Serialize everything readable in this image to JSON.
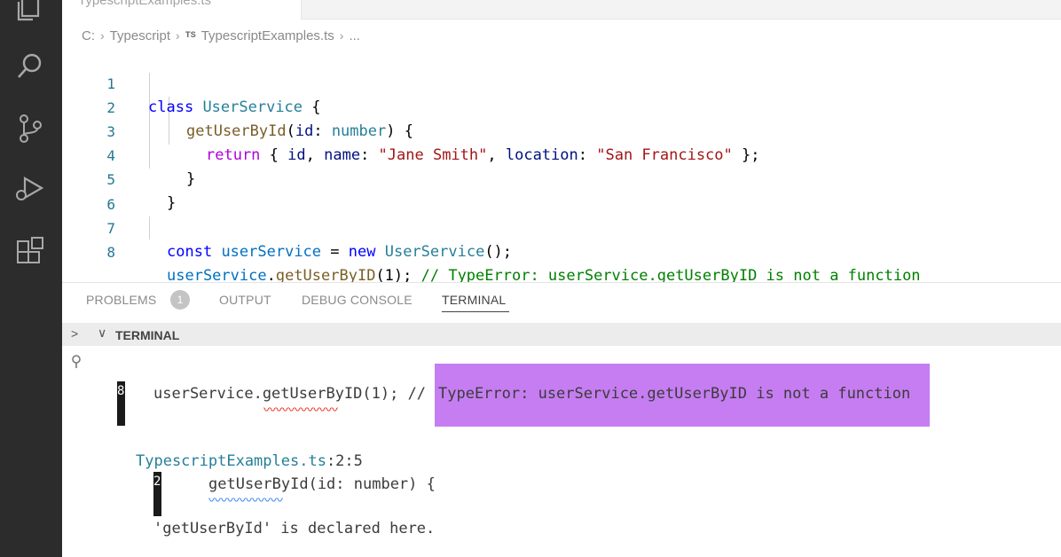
{
  "tab": {
    "label": "TypescriptExamples.ts"
  },
  "breadcrumb": {
    "root": "C:",
    "folder": "Typescript",
    "file_badge": "TS",
    "file": "TypescriptExamples.ts",
    "more": "..."
  },
  "editor": {
    "lines": [
      {
        "num": "1"
      },
      {
        "num": "2"
      },
      {
        "num": "3"
      },
      {
        "num": "4"
      },
      {
        "num": "5"
      },
      {
        "num": "6"
      },
      {
        "num": "7"
      },
      {
        "num": "8"
      }
    ],
    "tokens": {
      "l1_class": "class",
      "l1_name": "UserService",
      "l1_brace": " {",
      "l2_fn": "getUserById",
      "l2_open": "(",
      "l2_param": "id",
      "l2_colon": ": ",
      "l2_type": "number",
      "l2_close": ") {",
      "l3_return": "return",
      "l3_a": " { ",
      "l3_id": "id",
      "l3_b": ", ",
      "l3_name": "name",
      "l3_c": ": ",
      "l3_str1": "\"Jane Smith\"",
      "l3_d": ", ",
      "l3_loc": "location",
      "l3_e": ": ",
      "l3_str2": "\"San Francisco\"",
      "l3_f": " };",
      "l4": "}",
      "l5": "}",
      "l7_const": "const",
      "l7_var": "userService",
      "l7_eq": " = ",
      "l7_new": "new",
      "l7_cls": "UserService",
      "l7_end": "();",
      "l8_var": "userService",
      "l8_dot": ".",
      "l8_fn": "getUserByID",
      "l8_args": "(1); ",
      "l8_comment": "// TypeError: userService.getUserByID is not a function"
    }
  },
  "panel": {
    "tabs": {
      "problems": "PROBLEMS",
      "problems_count": "1",
      "output": "OUTPUT",
      "debug": "DEBUG CONSOLE",
      "terminal": "TERMINAL"
    },
    "terminal_header": "TERMINAL"
  },
  "terminal": {
    "line_num_1": "8",
    "error_code": "userService.getUserByID(1); // ",
    "error_highlight": "TypeError: userService.getUserByID is not a function",
    "file_ref": "TypescriptExamples.ts",
    "file_pos": ":2:5",
    "line_num_2": "2",
    "decl_code": "getUserById(id: number) {",
    "note": "'getUserById' is declared here."
  },
  "colors": {
    "activity_bar": "#2c2c2c",
    "highlight": "#c67df1",
    "keyword": "#0000ff",
    "class": "#267f99",
    "comment": "#008000",
    "string": "#a31515",
    "error_squiggle": "#e51400"
  },
  "icons": {
    "activity": [
      "files-icon",
      "search-icon",
      "source-control-icon",
      "run-debug-icon",
      "extensions-icon"
    ]
  }
}
